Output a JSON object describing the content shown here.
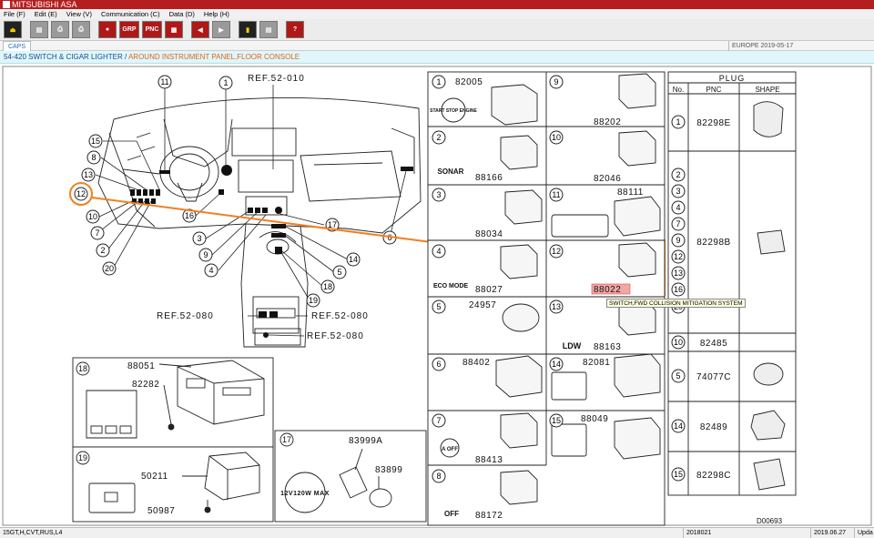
{
  "app": {
    "title": "MITSUBISHI ASA"
  },
  "menu": [
    "File (F)",
    "Edit (E)",
    "View (V)",
    "Communication (C)",
    "Data (D)",
    "Help (H)"
  ],
  "toolbar": {
    "buttons": [
      {
        "name": "exit-button",
        "label": "⏏",
        "style": "dark"
      },
      {
        "name": "open-button",
        "label": "▤",
        "style": "gray"
      },
      {
        "name": "print-button",
        "label": "⎙",
        "style": "gray"
      },
      {
        "name": "print-preview-button",
        "label": "⎙",
        "style": "gray"
      },
      {
        "name": "search-button",
        "label": "●",
        "style": "red"
      },
      {
        "name": "grp-button",
        "label": "GRP",
        "style": "red"
      },
      {
        "name": "pnc-button",
        "label": "PNC",
        "style": "red"
      },
      {
        "name": "grid-button",
        "label": "▦",
        "style": "red"
      },
      {
        "name": "prev-button",
        "label": "◀",
        "style": "red"
      },
      {
        "name": "next-button",
        "label": "▶",
        "style": "gray"
      },
      {
        "name": "bookmark-button",
        "label": "▮",
        "style": "dark"
      },
      {
        "name": "save-button",
        "label": "▤",
        "style": "gray"
      },
      {
        "name": "help-button",
        "label": "?",
        "style": "red"
      }
    ]
  },
  "tabs": {
    "active": "CAPS"
  },
  "region": "EUROPE   2019-05-17",
  "breadcrumb": {
    "code": "54-420",
    "title": "SWITCH & CIGAR LIGHTER",
    "separator": " / ",
    "location": "AROUND INSTRUMENT PANEL,FLOOR CONSOLE"
  },
  "diagram": {
    "refs": [
      "REF.52-010",
      "REF.52-080",
      "REF.52-080",
      "REF.52-080"
    ],
    "callouts": [
      "11",
      "1",
      "15",
      "8",
      "13",
      "12",
      "10",
      "7",
      "2",
      "20",
      "16",
      "3",
      "9",
      "4",
      "6",
      "17",
      "5",
      "14",
      "18",
      "19"
    ],
    "highlighted_callout": "12",
    "diagram_code": "D00693"
  },
  "detail_cells": [
    {
      "num": "1",
      "parts": [
        "82005"
      ],
      "label": "START STOP ENGINE"
    },
    {
      "num": "9",
      "parts": [
        "88202"
      ],
      "label": ""
    },
    {
      "num": "2",
      "parts": [
        "88166"
      ],
      "label": "SONAR"
    },
    {
      "num": "10",
      "parts": [
        "82046"
      ],
      "label": ""
    },
    {
      "num": "3",
      "parts": [
        "88034"
      ],
      "label": ""
    },
    {
      "num": "11",
      "parts": [
        "88111"
      ],
      "label": ""
    },
    {
      "num": "4",
      "parts": [
        "88027"
      ],
      "label": "ECO MODE"
    },
    {
      "num": "12",
      "parts": [
        "88022"
      ],
      "label": ""
    },
    {
      "num": "5",
      "parts": [
        "24957"
      ],
      "label": ""
    },
    {
      "num": "13",
      "parts": [
        "88163"
      ],
      "label": "LDW"
    },
    {
      "num": "6",
      "parts": [
        "88402"
      ],
      "label": ""
    },
    {
      "num": "14",
      "parts": [
        "82081"
      ],
      "label": ""
    },
    {
      "num": "7",
      "parts": [
        "88413"
      ],
      "label": "A OFF"
    },
    {
      "num": "15",
      "parts": [
        "88049"
      ],
      "label": ""
    },
    {
      "num": "8",
      "parts": [
        "88172"
      ],
      "label": "OFF"
    }
  ],
  "lower_boxes": [
    {
      "num": "18",
      "parts": [
        "88051",
        "82282"
      ]
    },
    {
      "num": "19",
      "parts": [
        "50211",
        "50987"
      ]
    },
    {
      "num": "17",
      "parts": [
        "83999A",
        "83899"
      ],
      "label": "12V120W MAX"
    }
  ],
  "tooltip": "SWITCH,FWD COLLISION MITIGATION SYSTEM",
  "plug_table": {
    "title": "PLUG",
    "headers": [
      "No.",
      "PNC",
      "SHAPE"
    ],
    "rows": [
      {
        "nos": [
          "1"
        ],
        "pnc": "82298E"
      },
      {
        "nos": [
          "2",
          "3",
          "4",
          "7",
          "9",
          "12",
          "13",
          "16",
          "20"
        ],
        "pnc": "82298B"
      },
      {
        "nos": [
          "10"
        ],
        "pnc": "82485"
      },
      {
        "nos": [
          "5"
        ],
        "pnc": "74077C"
      },
      {
        "nos": [
          "14"
        ],
        "pnc": "82489"
      },
      {
        "nos": [
          "15"
        ],
        "pnc": "82298C"
      }
    ]
  },
  "status": [
    "15GT,H,CVT,RUS,L4",
    "2018021",
    "2019.06.27",
    "Upda"
  ],
  "colors": {
    "brand": "#b41e1e",
    "highlight": "#f08020",
    "breadcrumb_bg": "#dff6fb"
  }
}
